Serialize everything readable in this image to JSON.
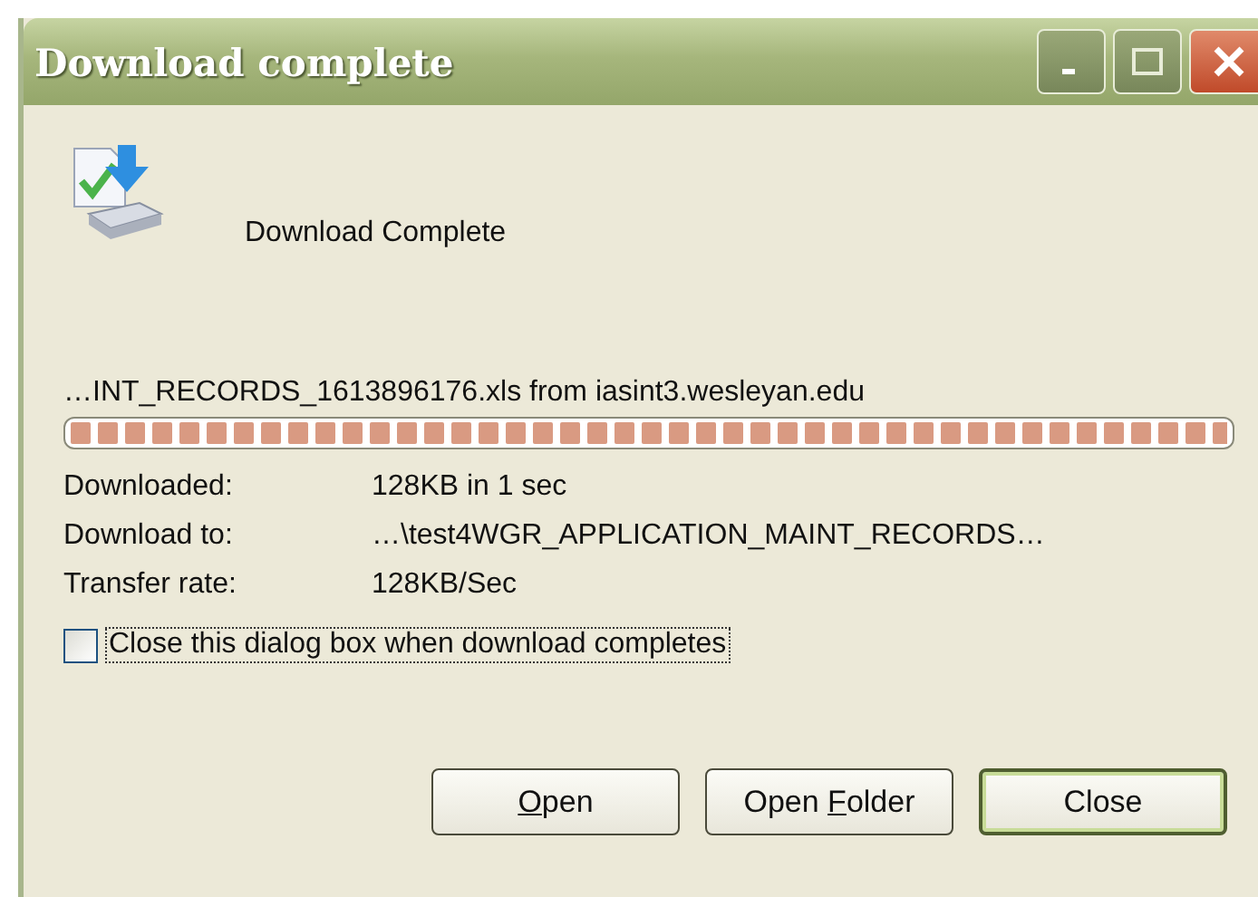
{
  "window": {
    "title": "Download complete"
  },
  "status": {
    "heading": "Download Complete"
  },
  "file_line": "…INT_RECORDS_1613896176.xls from iasint3.wesleyan.edu",
  "progress": {
    "level": 1
  },
  "details": [
    {
      "label": "Downloaded:",
      "value": "128KB in 1 sec"
    },
    {
      "label": "Download to:",
      "value": "…\\test4WGR_APPLICATION_MAINT_RECORDS…"
    },
    {
      "label": "Transfer rate:",
      "value": "128KB/Sec"
    }
  ],
  "close_when_done": {
    "label": "Close this dialog box when download completes",
    "checked": false,
    "focused": true
  },
  "buttons": [
    {
      "key": "O",
      "after": "pen",
      "default": false
    },
    {
      "before": "Open ",
      "key": "F",
      "after": "older",
      "default": false
    },
    {
      "before": "Close",
      "default": true
    }
  ]
}
